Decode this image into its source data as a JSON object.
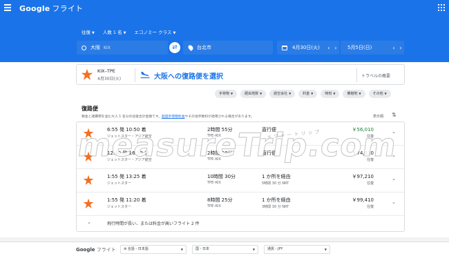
{
  "appbar": {
    "brand": "Google",
    "product": "フライト"
  },
  "search": {
    "trip_type": "往復",
    "passengers": "人数 1 名",
    "cabin": "エコノミー クラス",
    "origin": "大阪",
    "origin_code": "KIX",
    "destination": "台北市",
    "depart_date": "4月30日(火)",
    "return_date": "5月5日(日)"
  },
  "route": {
    "code": "KIX–TPE",
    "date": "4月30日(火)",
    "title": "大阪への復路便を選択",
    "overview": "トラベルの概要"
  },
  "filters": [
    {
      "label": "手荷物"
    },
    {
      "label": "経由地数"
    },
    {
      "label": "航空会社"
    },
    {
      "label": "料金"
    },
    {
      "label": "時刻"
    },
    {
      "label": "乗継地"
    },
    {
      "label": "その他"
    }
  ],
  "results": {
    "heading": "復路便",
    "note_before": "税金と諸費用を含む大人 1 名分の往復合計金額です。",
    "note_link": "超過手荷物料金",
    "note_after": "やその他手数料が適用される場合があります。",
    "sort_label": "表示順:",
    "flights": [
      {
        "times": "6:55 発 10:50 着",
        "airline": "ジェットスター・アジア航空",
        "duration": "2時間 55分",
        "route": "TPE–KIX",
        "stops": "直行便",
        "stop_detail": "",
        "price": "￥56,010",
        "price_type": "往復",
        "cheapest": true
      },
      {
        "times": "12:40 発 16:30 着",
        "airline": "ジェットスター・アジア航空",
        "duration": "2時間 50分",
        "route": "TPE–KIX",
        "stops": "直行便",
        "stop_detail": "",
        "price": "￥74,410",
        "price_type": "往復",
        "cheapest": false
      },
      {
        "times": "1:55 発 13:25 着",
        "airline": "ジェットスター",
        "duration": "10時間 30分",
        "route": "TPE–KIX",
        "stops": "1 か所を経由",
        "stop_detail": "5時間 30 分 NRT",
        "price": "￥97,210",
        "price_type": "往復",
        "cheapest": false
      },
      {
        "times": "1:55 発 11:20 着",
        "airline": "ジェットスター",
        "duration": "8時間 25分",
        "route": "TPE–KIX",
        "stops": "1 か所を経由",
        "stop_detail": "3時間 30 分 NRT",
        "price": "￥99,410",
        "price_type": "往復",
        "cheapest": false
      }
    ],
    "more_label": "飛行時間が長い、または料金が高いフライト 2 件"
  },
  "watermark": {
    "text": "measureTrip.com",
    "sub": "メジャートリップ"
  },
  "footer": {
    "brand": "Google",
    "product": "フライト",
    "language": "言語 - 日本語",
    "country": "国 - 日本",
    "currency": "通貨 - JPY"
  },
  "colors": {
    "primary": "#1a73e8",
    "cheap": "#188038",
    "jetstar": "#f36f21"
  }
}
